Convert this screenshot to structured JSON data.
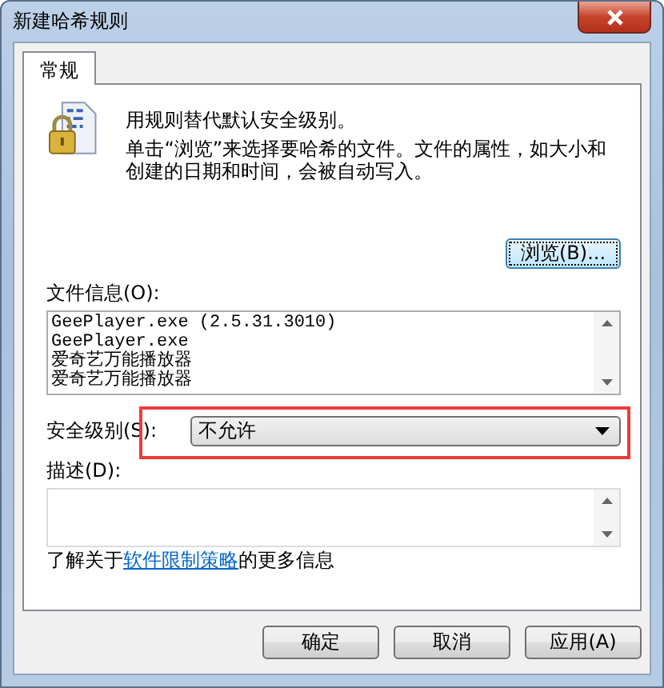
{
  "window": {
    "title": "新建哈希规则"
  },
  "tabs": [
    {
      "label": "常规",
      "selected": true
    }
  ],
  "intro": {
    "line1": "用规则替代默认安全级别。",
    "line2": "单击“浏览”来选择要哈希的文件。文件的属性，如大小和创建的日期和时间，会被自动写入。"
  },
  "browse_button": "浏览(B)...",
  "file_info": {
    "label": "文件信息(O):",
    "lines": [
      "GeePlayer.exe (2.5.31.3010)",
      "GeePlayer.exe",
      "爱奇艺万能播放器",
      "爱奇艺万能播放器"
    ]
  },
  "security_level": {
    "label": "安全级别(S):",
    "value": "不允许"
  },
  "description": {
    "label": "描述(D):"
  },
  "more_info": {
    "before": "了解关于",
    "link": "软件限制策略",
    "after": "的更多信息"
  },
  "buttons": [
    {
      "label": "确定",
      "disabled": false
    },
    {
      "label": "取消",
      "disabled": false
    },
    {
      "label": "应用(A)",
      "disabled": false
    }
  ]
}
